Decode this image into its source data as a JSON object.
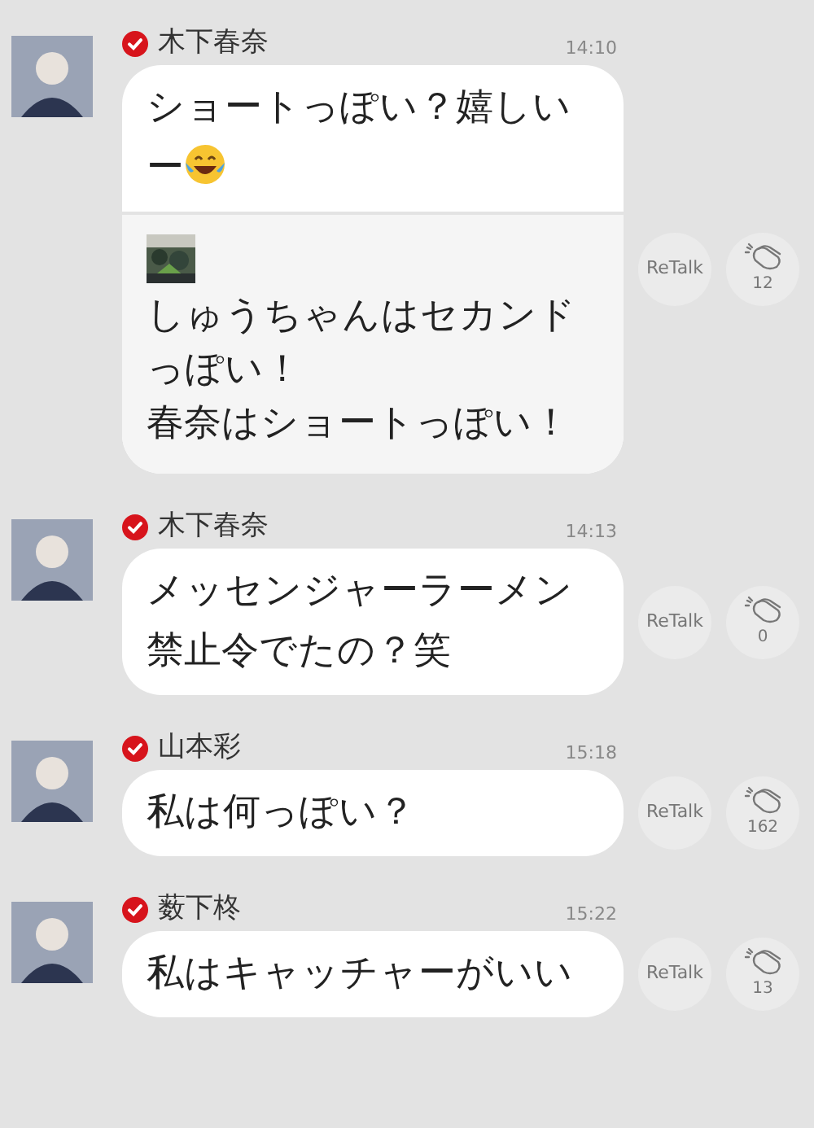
{
  "messages": [
    {
      "name": "木下春奈",
      "time": "14:10",
      "text": "ショートっぽい？嬉しいー",
      "emoji": true,
      "quote": {
        "lines": [
          "しゅうちゃんはセカンドっぽい！",
          "春奈はショートっぽい！"
        ]
      },
      "retalk": "ReTalk",
      "claps": "12"
    },
    {
      "name": "木下春奈",
      "time": "14:13",
      "text": "メッセンジャーラーメン禁止令でたの？笑",
      "emoji": false,
      "retalk": "ReTalk",
      "claps": "0"
    },
    {
      "name": "山本彩",
      "time": "15:18",
      "text": "私は何っぽい？",
      "emoji": false,
      "retalk": "ReTalk",
      "claps": "162"
    },
    {
      "name": "薮下柊",
      "time": "15:22",
      "text": "私はキャッチャーがいい",
      "emoji": false,
      "retalk": "ReTalk",
      "claps": "13"
    }
  ]
}
